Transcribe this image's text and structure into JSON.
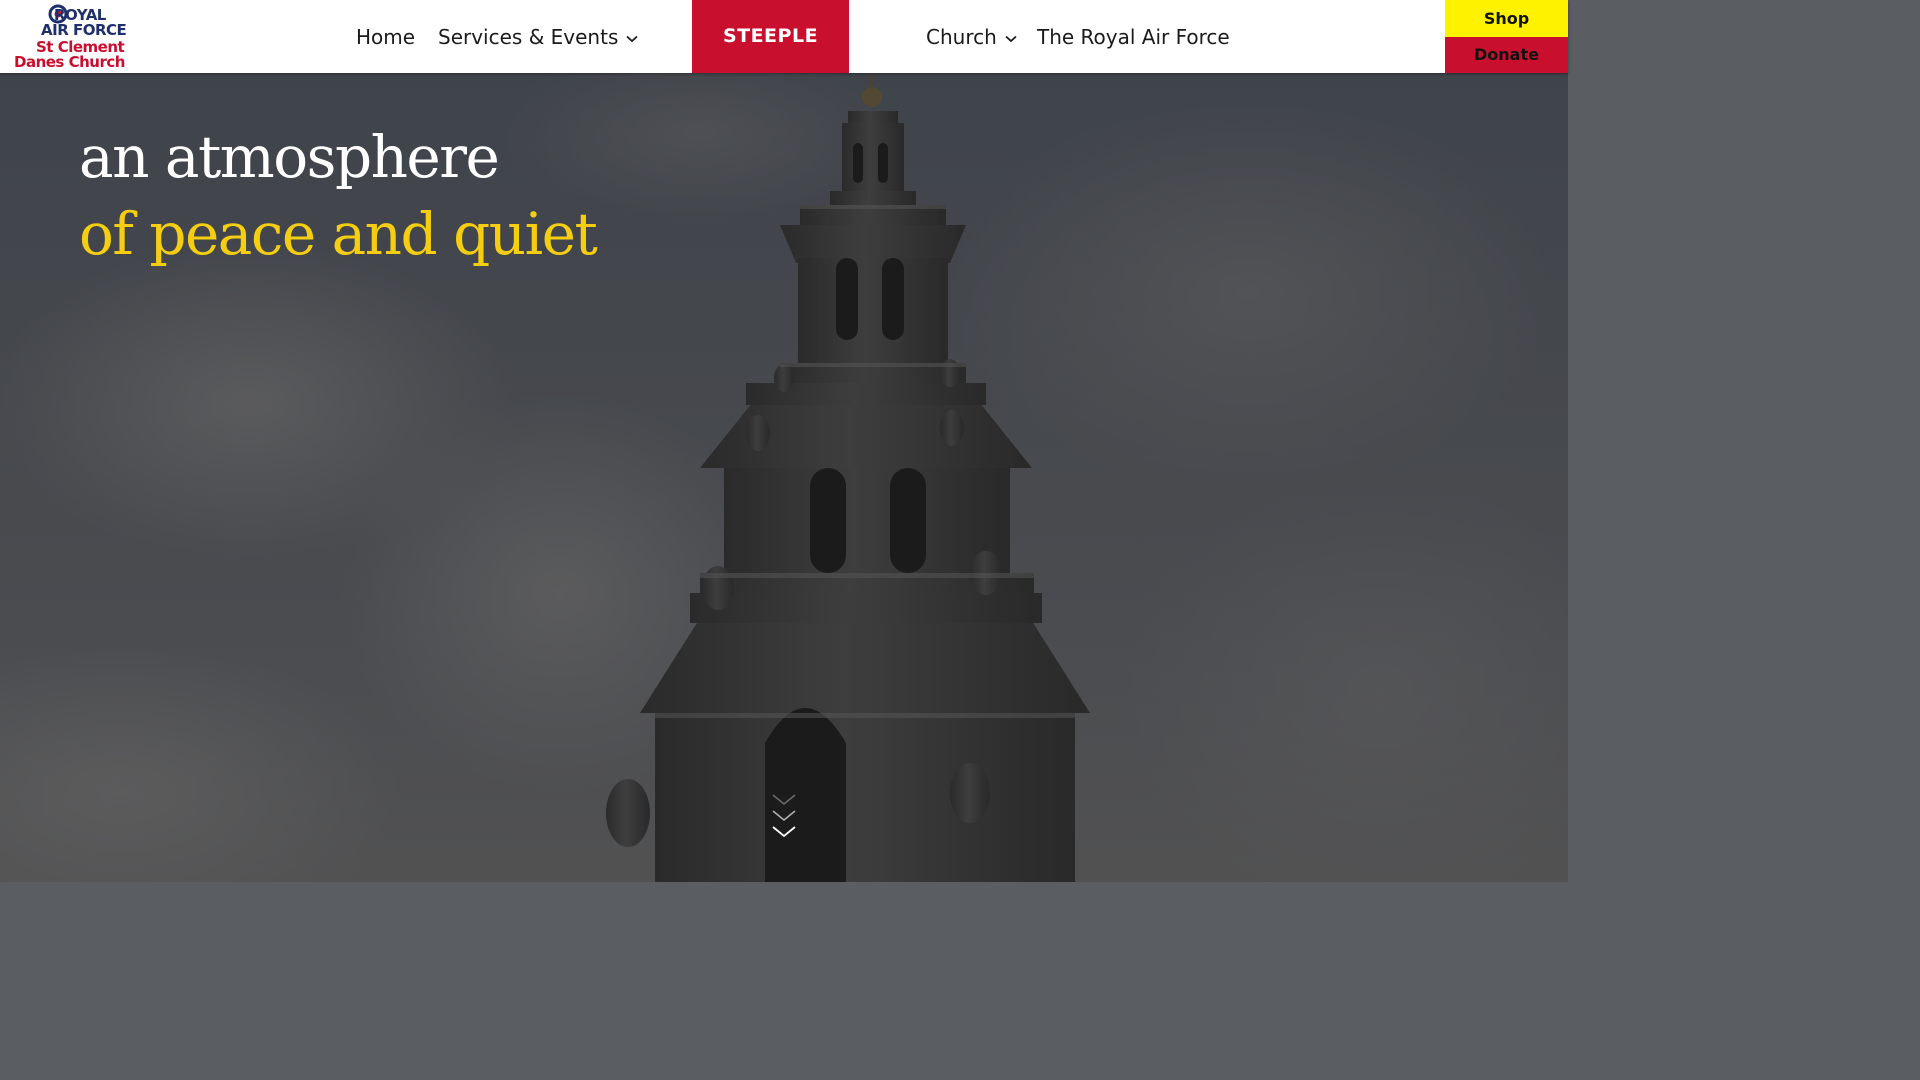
{
  "logo": {
    "lines": [
      "ROYAL",
      "AIR FORCE",
      "St Clement",
      "Danes Church"
    ],
    "icon": "raf-roundel-icon",
    "colors": {
      "navy": "#1f2f6b",
      "red": "#c8102e"
    }
  },
  "nav": {
    "items": [
      {
        "label": "Home",
        "has_dropdown": false
      },
      {
        "label": "Services & Events",
        "has_dropdown": true
      },
      {
        "label": "Church",
        "has_dropdown": true
      },
      {
        "label": "The Royal Air Force",
        "has_dropdown": false
      }
    ],
    "steeple_label": "STEEPLE",
    "shop_label": "Shop",
    "donate_label": "Donate"
  },
  "hero": {
    "headline_line1": "an atmosphere",
    "headline_line2": "of peace and quiet",
    "scroll_icon": "chevron-down-icon"
  },
  "colors": {
    "accent_red": "#c8102e",
    "accent_yellow": "#fff200",
    "headline_yellow": "#f5cd11",
    "header_bg": "#ffffff"
  }
}
